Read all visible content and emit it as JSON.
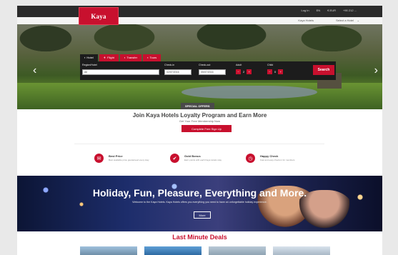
{
  "brand": {
    "logo_text": "Kaya",
    "primary_color": "#c8102e",
    "dark_color": "#1c1c1c"
  },
  "topbar": {
    "links": [
      "Log In",
      "EN",
      "€ EUR",
      "+90 212 ..."
    ]
  },
  "subbar": {
    "left_link": "Kaya Hotels",
    "right_link": "Select a Hotel"
  },
  "hero": {
    "tabs": [
      {
        "label": "Hotel",
        "icon": "bed-icon"
      },
      {
        "label": "Flight",
        "icon": "plane-icon"
      },
      {
        "label": "Transfer",
        "icon": "car-icon"
      },
      {
        "label": "Tours",
        "icon": "map-icon"
      }
    ],
    "fields": {
      "destination": {
        "label": "Region/Hotel",
        "value": "All"
      },
      "checkin": {
        "label": "Check-in",
        "value": "02/07/2016"
      },
      "checkout": {
        "label": "Check-out",
        "value": "05/07/2016"
      },
      "adults": {
        "label": "Adult",
        "value": "2"
      },
      "children": {
        "label": "Child",
        "value": "0"
      }
    },
    "search_button": "Search",
    "offers_label": "SPECIAL OFFERS"
  },
  "loyalty": {
    "title": "Join Kaya Hotels Loyalty Program and Earn More",
    "subtitle": "Get Your Free Membership Now",
    "button": "Complete Free Sign Up",
    "features": [
      {
        "icon": "gift-icon",
        "title": "Best Price",
        "desc": "Best available price guaranteed every stay"
      },
      {
        "icon": "thumbs-up-icon",
        "title": "Gold Bonus",
        "desc": "Earn points with each Kaya Hotels stay"
      },
      {
        "icon": "clock-icon",
        "title": "Happy Check",
        "desc": "Fast and easy check-in for members"
      }
    ]
  },
  "banner": {
    "title": "Holiday, Fun, Pleasure, Everything and More.",
    "subtitle": "Welcome to the Kaya Hotels. Kaya Hotels offers you everything you need to have an unforgettable holiday experience.",
    "button": "More"
  },
  "deals": {
    "title": "Last Minute Deals"
  }
}
